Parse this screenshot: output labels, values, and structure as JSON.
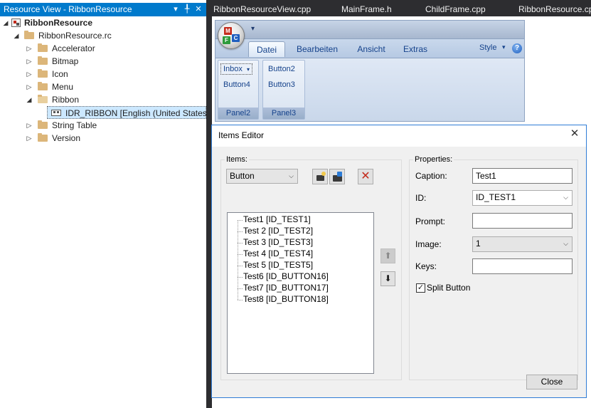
{
  "resource_view": {
    "title": "Resource View - RibbonResource",
    "title_buttons": [
      "▾",
      "╀",
      "✕"
    ],
    "tree": {
      "root": "RibbonResource",
      "rc_file": "RibbonResource.rc",
      "folders": [
        {
          "label": "Accelerator",
          "expanded": false
        },
        {
          "label": "Bitmap",
          "expanded": false
        },
        {
          "label": "Icon",
          "expanded": false
        },
        {
          "label": "Menu",
          "expanded": false
        },
        {
          "label": "Ribbon",
          "expanded": true
        },
        {
          "label": "String Table",
          "expanded": false
        },
        {
          "label": "Version",
          "expanded": false
        }
      ],
      "ribbon_child": "IDR_RIBBON [English (United States)]"
    }
  },
  "doc_tabs": [
    "RibbonResourceView.cpp",
    "MainFrame.h",
    "ChildFrame.cpp",
    "RibbonResource.cpp"
  ],
  "ribbon": {
    "app_button_letters": [
      "M",
      "F",
      "C"
    ],
    "qat_arrow": "▾",
    "tabs": [
      {
        "label": "Datei",
        "active": true
      },
      {
        "label": "Bearbeiten",
        "active": false
      },
      {
        "label": "Ansicht",
        "active": false
      },
      {
        "label": "Extras",
        "active": false
      }
    ],
    "style_label": "Style",
    "style_arrow": "▾",
    "help_glyph": "?",
    "panels": [
      {
        "caption": "Panel2",
        "items": [
          "Inbox",
          "Button4"
        ],
        "inbox_arrow": "▾"
      },
      {
        "caption": "Panel3",
        "items": [
          "Button2",
          "Button3"
        ]
      }
    ]
  },
  "items_editor": {
    "title": "Items Editor",
    "close_glyph": "✕",
    "items_group_label": "Items:",
    "item_type": "Button",
    "combo_arrow": "⌵",
    "delete_glyph": "✕",
    "tree_items": [
      "Test1 [ID_TEST1]",
      "Test 2 [ID_TEST2]",
      "Test 3 [ID_TEST3]",
      "Test 4 [ID_TEST4]",
      "Test 5 [ID_TEST5]",
      "Test6 [ID_BUTTON16]",
      "Test7 [ID_BUTTON17]",
      "Test8 [ID_BUTTON18]"
    ],
    "move_up_glyph": "⬆",
    "move_down_glyph": "⬇",
    "properties_group_label": "Properties:",
    "properties": {
      "caption_label": "Caption:",
      "caption_value": "Test1",
      "id_label": "ID:",
      "id_value": "ID_TEST1",
      "prompt_label": "Prompt:",
      "prompt_value": "",
      "image_label": "Image:",
      "image_value": "1",
      "keys_label": "Keys:",
      "keys_value": "",
      "split_button_label": "Split Button",
      "split_button_checked": true,
      "check_glyph": "✓"
    },
    "close_button": "Close"
  },
  "colors": {
    "accent": "#007acc",
    "dark_chrome": "#2d2d30",
    "ribbon_text": "#15428b",
    "dialog_border": "#2e7cd6",
    "delete_red": "#c42b1c"
  }
}
